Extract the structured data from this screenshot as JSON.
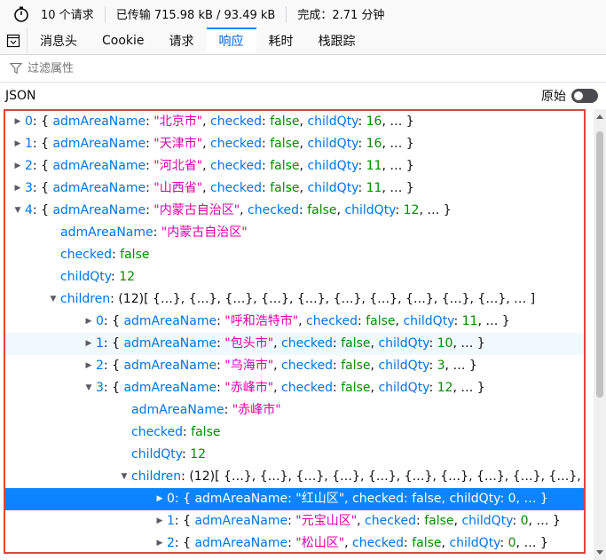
{
  "status": {
    "requests": "10 个请求",
    "transferred": "已传输 715.98 kB / 93.49 kB",
    "finish": "完成：2.71 分钟"
  },
  "tabs": [
    {
      "label": "消息头"
    },
    {
      "label": "Cookie"
    },
    {
      "label": "请求"
    },
    {
      "label": "响应"
    },
    {
      "label": "耗时"
    },
    {
      "label": "栈跟踪"
    }
  ],
  "active_tab": "响应",
  "filter": {
    "placeholder": "过滤属性",
    "value": ""
  },
  "json_header": {
    "label": "JSON",
    "raw_label": "原始",
    "raw_enabled": false
  },
  "colors": {
    "selection": "#0a84ff",
    "string": "#dd00a9",
    "key": "#0074e8",
    "literal": "#058b00",
    "highlight_border": "#e0443e"
  },
  "tree": {
    "rows": [
      {
        "indent": 0,
        "twisty": "collapsed",
        "parts": [
          [
            "k",
            "0"
          ],
          [
            "p",
            ": { "
          ],
          [
            "k",
            "admAreaName"
          ],
          [
            "p",
            ": "
          ],
          [
            "s",
            "\"北京市\""
          ],
          [
            "p",
            ", "
          ],
          [
            "k",
            "checked"
          ],
          [
            "p",
            ": "
          ],
          [
            "b",
            "false"
          ],
          [
            "p",
            ", "
          ],
          [
            "k",
            "childQty"
          ],
          [
            "p",
            ": "
          ],
          [
            "n",
            "16"
          ],
          [
            "p",
            ", … }"
          ]
        ]
      },
      {
        "indent": 0,
        "twisty": "collapsed",
        "parts": [
          [
            "k",
            "1"
          ],
          [
            "p",
            ": { "
          ],
          [
            "k",
            "admAreaName"
          ],
          [
            "p",
            ": "
          ],
          [
            "s",
            "\"天津市\""
          ],
          [
            "p",
            ", "
          ],
          [
            "k",
            "checked"
          ],
          [
            "p",
            ": "
          ],
          [
            "b",
            "false"
          ],
          [
            "p",
            ", "
          ],
          [
            "k",
            "childQty"
          ],
          [
            "p",
            ": "
          ],
          [
            "n",
            "16"
          ],
          [
            "p",
            ", … }"
          ]
        ]
      },
      {
        "indent": 0,
        "twisty": "collapsed",
        "parts": [
          [
            "k",
            "2"
          ],
          [
            "p",
            ": { "
          ],
          [
            "k",
            "admAreaName"
          ],
          [
            "p",
            ": "
          ],
          [
            "s",
            "\"河北省\""
          ],
          [
            "p",
            ", "
          ],
          [
            "k",
            "checked"
          ],
          [
            "p",
            ": "
          ],
          [
            "b",
            "false"
          ],
          [
            "p",
            ", "
          ],
          [
            "k",
            "childQty"
          ],
          [
            "p",
            ": "
          ],
          [
            "n",
            "11"
          ],
          [
            "p",
            ", … }"
          ]
        ]
      },
      {
        "indent": 0,
        "twisty": "collapsed",
        "parts": [
          [
            "k",
            "3"
          ],
          [
            "p",
            ": { "
          ],
          [
            "k",
            "admAreaName"
          ],
          [
            "p",
            ": "
          ],
          [
            "s",
            "\"山西省\""
          ],
          [
            "p",
            ", "
          ],
          [
            "k",
            "checked"
          ],
          [
            "p",
            ": "
          ],
          [
            "b",
            "false"
          ],
          [
            "p",
            ", "
          ],
          [
            "k",
            "childQty"
          ],
          [
            "p",
            ": "
          ],
          [
            "n",
            "11"
          ],
          [
            "p",
            ", … }"
          ]
        ]
      },
      {
        "indent": 0,
        "twisty": "expanded",
        "parts": [
          [
            "k",
            "4"
          ],
          [
            "p",
            ": { "
          ],
          [
            "k",
            "admAreaName"
          ],
          [
            "p",
            ": "
          ],
          [
            "s",
            "\"内蒙古自治区\""
          ],
          [
            "p",
            ", "
          ],
          [
            "k",
            "checked"
          ],
          [
            "p",
            ": "
          ],
          [
            "b",
            "false"
          ],
          [
            "p",
            ", "
          ],
          [
            "k",
            "childQty"
          ],
          [
            "p",
            ": "
          ],
          [
            "n",
            "12"
          ],
          [
            "p",
            ", … }"
          ]
        ]
      },
      {
        "indent": 1,
        "twisty": "none",
        "parts": [
          [
            "k",
            "admAreaName"
          ],
          [
            "p",
            ": "
          ],
          [
            "s",
            "\"内蒙古自治区\""
          ]
        ]
      },
      {
        "indent": 1,
        "twisty": "none",
        "parts": [
          [
            "k",
            "checked"
          ],
          [
            "p",
            ": "
          ],
          [
            "b",
            "false"
          ]
        ]
      },
      {
        "indent": 1,
        "twisty": "none",
        "parts": [
          [
            "k",
            "childQty"
          ],
          [
            "p",
            ": "
          ],
          [
            "n",
            "12"
          ]
        ]
      },
      {
        "indent": 1,
        "twisty": "expanded",
        "parts": [
          [
            "k",
            "children"
          ],
          [
            "p",
            ": (12)[ {…}, {…}, {…}, {…}, {…}, {…}, {…}, {…}, {…}, {…}, … ]"
          ]
        ]
      },
      {
        "indent": 2,
        "twisty": "collapsed",
        "parts": [
          [
            "k",
            "0"
          ],
          [
            "p",
            ": { "
          ],
          [
            "k",
            "admAreaName"
          ],
          [
            "p",
            ": "
          ],
          [
            "s",
            "\"呼和浩特市\""
          ],
          [
            "p",
            ", "
          ],
          [
            "k",
            "checked"
          ],
          [
            "p",
            ": "
          ],
          [
            "b",
            "false"
          ],
          [
            "p",
            ", "
          ],
          [
            "k",
            "childQty"
          ],
          [
            "p",
            ": "
          ],
          [
            "n",
            "11"
          ],
          [
            "p",
            ", … }"
          ]
        ]
      },
      {
        "indent": 2,
        "twisty": "collapsed",
        "state": "hover",
        "parts": [
          [
            "k",
            "1"
          ],
          [
            "p",
            ": { "
          ],
          [
            "k",
            "admAreaName"
          ],
          [
            "p",
            ": "
          ],
          [
            "s",
            "\"包头市\""
          ],
          [
            "p",
            ", "
          ],
          [
            "k",
            "checked"
          ],
          [
            "p",
            ": "
          ],
          [
            "b",
            "false"
          ],
          [
            "p",
            ", "
          ],
          [
            "k",
            "childQty"
          ],
          [
            "p",
            ": "
          ],
          [
            "n",
            "10"
          ],
          [
            "p",
            ", … }"
          ]
        ]
      },
      {
        "indent": 2,
        "twisty": "collapsed",
        "parts": [
          [
            "k",
            "2"
          ],
          [
            "p",
            ": { "
          ],
          [
            "k",
            "admAreaName"
          ],
          [
            "p",
            ": "
          ],
          [
            "s",
            "\"乌海市\""
          ],
          [
            "p",
            ", "
          ],
          [
            "k",
            "checked"
          ],
          [
            "p",
            ": "
          ],
          [
            "b",
            "false"
          ],
          [
            "p",
            ", "
          ],
          [
            "k",
            "childQty"
          ],
          [
            "p",
            ": "
          ],
          [
            "n",
            "3"
          ],
          [
            "p",
            ", … }"
          ]
        ]
      },
      {
        "indent": 2,
        "twisty": "expanded",
        "parts": [
          [
            "k",
            "3"
          ],
          [
            "p",
            ": { "
          ],
          [
            "k",
            "admAreaName"
          ],
          [
            "p",
            ": "
          ],
          [
            "s",
            "\"赤峰市\""
          ],
          [
            "p",
            ", "
          ],
          [
            "k",
            "checked"
          ],
          [
            "p",
            ": "
          ],
          [
            "b",
            "false"
          ],
          [
            "p",
            ", "
          ],
          [
            "k",
            "childQty"
          ],
          [
            "p",
            ": "
          ],
          [
            "n",
            "12"
          ],
          [
            "p",
            ", … }"
          ]
        ]
      },
      {
        "indent": 3,
        "twisty": "none",
        "parts": [
          [
            "k",
            "admAreaName"
          ],
          [
            "p",
            ": "
          ],
          [
            "s",
            "\"赤峰市\""
          ]
        ]
      },
      {
        "indent": 3,
        "twisty": "none",
        "parts": [
          [
            "k",
            "checked"
          ],
          [
            "p",
            ": "
          ],
          [
            "b",
            "false"
          ]
        ]
      },
      {
        "indent": 3,
        "twisty": "none",
        "parts": [
          [
            "k",
            "childQty"
          ],
          [
            "p",
            ": "
          ],
          [
            "n",
            "12"
          ]
        ]
      },
      {
        "indent": 3,
        "twisty": "expanded",
        "parts": [
          [
            "k",
            "children"
          ],
          [
            "p",
            ": (12)[ {…}, {…}, {…}, {…}, {…}, {…}, {…}, {…}, {…}, {…}, … ]"
          ]
        ]
      },
      {
        "indent": 4,
        "twisty": "collapsed",
        "state": "selected",
        "parts": [
          [
            "k",
            "0"
          ],
          [
            "p",
            ": { "
          ],
          [
            "k",
            "admAreaName"
          ],
          [
            "p",
            ": "
          ],
          [
            "s",
            "\"红山区\""
          ],
          [
            "p",
            ", "
          ],
          [
            "k",
            "checked"
          ],
          [
            "p",
            ": "
          ],
          [
            "b",
            "false"
          ],
          [
            "p",
            ", "
          ],
          [
            "k",
            "childQty"
          ],
          [
            "p",
            ": "
          ],
          [
            "n",
            "0"
          ],
          [
            "p",
            ", … }"
          ]
        ]
      },
      {
        "indent": 4,
        "twisty": "collapsed",
        "parts": [
          [
            "k",
            "1"
          ],
          [
            "p",
            ": { "
          ],
          [
            "k",
            "admAreaName"
          ],
          [
            "p",
            ": "
          ],
          [
            "s",
            "\"元宝山区\""
          ],
          [
            "p",
            ", "
          ],
          [
            "k",
            "checked"
          ],
          [
            "p",
            ": "
          ],
          [
            "b",
            "false"
          ],
          [
            "p",
            ", "
          ],
          [
            "k",
            "childQty"
          ],
          [
            "p",
            ": "
          ],
          [
            "n",
            "0"
          ],
          [
            "p",
            ", … }"
          ]
        ]
      },
      {
        "indent": 4,
        "twisty": "collapsed",
        "parts": [
          [
            "k",
            "2"
          ],
          [
            "p",
            ": { "
          ],
          [
            "k",
            "admAreaName"
          ],
          [
            "p",
            ": "
          ],
          [
            "s",
            "\"松山区\""
          ],
          [
            "p",
            ", "
          ],
          [
            "k",
            "checked"
          ],
          [
            "p",
            ": "
          ],
          [
            "b",
            "false"
          ],
          [
            "p",
            ", "
          ],
          [
            "k",
            "childQty"
          ],
          [
            "p",
            ": "
          ],
          [
            "n",
            "0"
          ],
          [
            "p",
            ", … }"
          ]
        ]
      }
    ]
  }
}
